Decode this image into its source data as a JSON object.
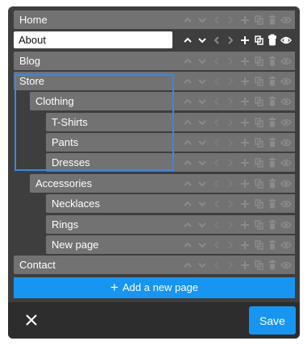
{
  "pages": [
    {
      "label": "Home",
      "depth": 0
    },
    {
      "label": "About",
      "depth": 0,
      "editing": true
    },
    {
      "label": "Blog",
      "depth": 0
    },
    {
      "label": "Store",
      "depth": 0,
      "selected": true
    },
    {
      "label": "Clothing",
      "depth": 1,
      "selected": true
    },
    {
      "label": "T-Shirts",
      "depth": 2,
      "selected": true
    },
    {
      "label": "Pants",
      "depth": 2,
      "selected": true
    },
    {
      "label": "Dresses",
      "depth": 2,
      "selected": true
    },
    {
      "label": "Accessories",
      "depth": 1
    },
    {
      "label": "Necklaces",
      "depth": 2
    },
    {
      "label": "Rings",
      "depth": 2
    },
    {
      "label": "New page",
      "depth": 2
    },
    {
      "label": "Contact",
      "depth": 0
    }
  ],
  "row_actions": [
    "move-up-icon",
    "move-down-icon",
    "outdent-icon",
    "indent-icon",
    "add-icon",
    "duplicate-icon",
    "trash-icon",
    "visibility-icon"
  ],
  "add_button": {
    "label": "Add a new page",
    "icon": "plus-icon"
  },
  "footer": {
    "close_icon": "close-icon",
    "save_label": "Save"
  },
  "colors": {
    "row": "#727272",
    "panel": "#3e3e3e",
    "footer": "#2d2d2d",
    "accent": "#1895f0",
    "selection": "#3b87e6"
  }
}
